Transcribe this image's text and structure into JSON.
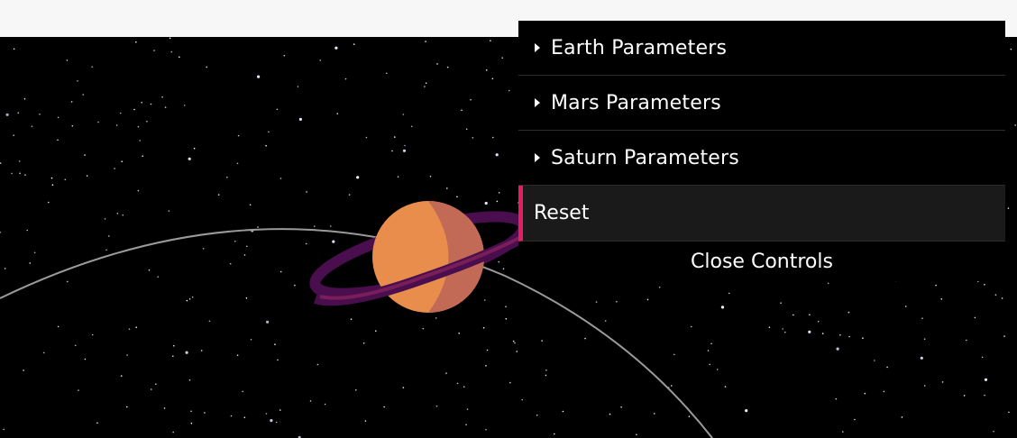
{
  "gui": {
    "folders": [
      {
        "label": "Earth Parameters"
      },
      {
        "label": "Mars Parameters"
      },
      {
        "label": "Saturn Parameters"
      }
    ],
    "reset_label": "Reset",
    "close_label": "Close Controls"
  },
  "colors": {
    "space": "#000000",
    "orbit": "#9a9a9a",
    "saturn_light": "#e88d4c",
    "saturn_shade": "#c26a55",
    "ring_outer": "#4a0e4e",
    "ring_inner": "#7a1e5a",
    "accent": "#e61d5f"
  }
}
